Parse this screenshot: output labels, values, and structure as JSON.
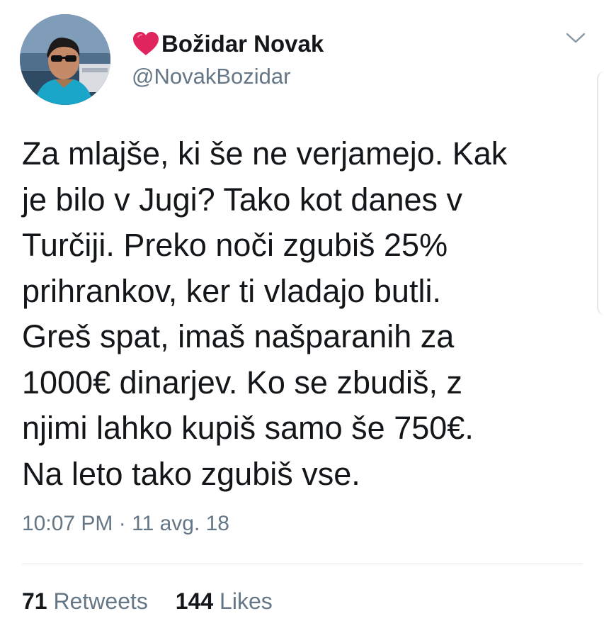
{
  "author": {
    "display_name": "Božidar Novak",
    "handle": "@NovakBozidar",
    "name_icon": "heart-icon",
    "name_icon_color": "#e0245e"
  },
  "tweet": {
    "text_lines": [
      "Za mlajše, ki še ne verjamejo. Kak",
      "je bilo v Jugi? Tako kot danes v",
      "Turčiji. Preko noči zgubiš 25%",
      "prihrankov, ker ti vladajo butli.",
      "Greš spat, imaš našparanih za",
      "1000€ dinarjev. Ko se zbudiš, z",
      "njimi lahko kupiš samo še 750€.",
      "Na leto tako zgubiš vse."
    ],
    "time": "10:07 PM",
    "separator": "·",
    "date": "11 avg. 18"
  },
  "stats": {
    "retweets_count": "71",
    "retweets_label": "Retweets",
    "likes_count": "144",
    "likes_label": "Likes"
  },
  "colors": {
    "text": "#14171a",
    "secondary": "#657786",
    "divider": "#e1e8ed"
  },
  "icons": {
    "menu_caret": "chevron-down-icon"
  }
}
